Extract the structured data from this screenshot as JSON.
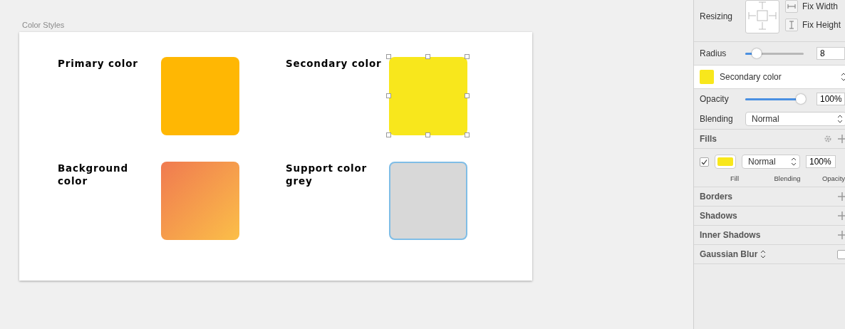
{
  "artboard": {
    "title": "Color Styles"
  },
  "swatches": [
    {
      "label": "Primary color",
      "kind": "solid",
      "color": "#ffb703",
      "selected": false,
      "hovered": false
    },
    {
      "label": "Secondary color",
      "kind": "solid",
      "color": "#f8e71c",
      "selected": true,
      "hovered": false
    },
    {
      "label": "Background color",
      "kind": "gradient",
      "color": "#f07a50",
      "selected": false,
      "hovered": false
    },
    {
      "label": "Support color grey",
      "kind": "solid",
      "color": "#d8d8d8",
      "selected": false,
      "hovered": true
    }
  ],
  "inspector": {
    "resizing": {
      "label": "Resizing",
      "fix_width": "Fix Width",
      "fix_height": "Fix Height"
    },
    "radius": {
      "label": "Radius",
      "level": 0.2,
      "value": "8"
    },
    "style": {
      "name": "Secondary color",
      "color": "#f8e71c"
    },
    "opacity": {
      "label": "Opacity",
      "level": 0.95,
      "value": "100%"
    },
    "blending": {
      "label": "Blending",
      "value": "Normal"
    },
    "fills": {
      "title": "Fills",
      "items": [
        {
          "checked": true,
          "color": "#f8e71c",
          "blending": "Normal",
          "opacity": "100%"
        }
      ],
      "captions": [
        "Fill",
        "Blending",
        "Opacity"
      ]
    },
    "sections": [
      {
        "title": "Borders",
        "kind": "add"
      },
      {
        "title": "Shadows",
        "kind": "add"
      },
      {
        "title": "Inner Shadows",
        "kind": "add"
      },
      {
        "title": "Gaussian Blur",
        "kind": "toggle",
        "checked": false
      }
    ]
  }
}
